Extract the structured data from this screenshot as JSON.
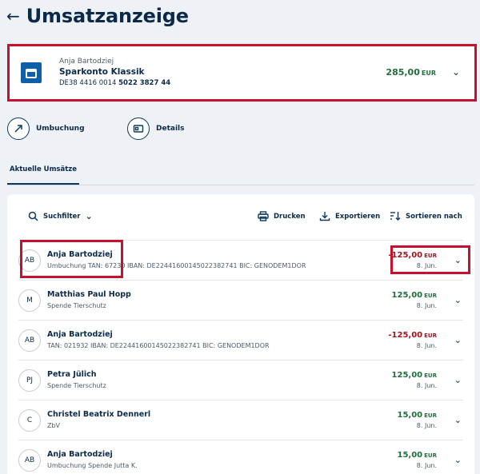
{
  "header": {
    "back_icon": "arrow-left-icon",
    "title": "Umsatzanzeige"
  },
  "account": {
    "owner": "Anja Bartodziej",
    "name": "Sparkonto Klassik",
    "iban_prefix": "DE38 4416 0014",
    "iban_suffix": "5022 3827 44",
    "amount": "285,00",
    "currency": "EUR"
  },
  "actions": {
    "transfer_label": "Umbuchung",
    "details_label": "Details"
  },
  "tabs": {
    "current_label": "Aktuelle Umsätze"
  },
  "toolbar": {
    "filter_label": "Suchfilter",
    "print_label": "Drucken",
    "export_label": "Exportieren",
    "sort_label": "Sortieren nach"
  },
  "transactions": [
    {
      "initials": "AB",
      "name": "Anja Bartodziej",
      "description": "Umbuchung TAN: 67230 IBAN: DE22441600145022382741 BIC: GENODEM1DOR",
      "amount": "-125,00",
      "currency": "EUR",
      "date": "8. Jun.",
      "negative": true
    },
    {
      "initials": "M",
      "name": "Matthias Paul Hopp",
      "description": "Spende Tierschutz",
      "amount": "125,00",
      "currency": "EUR",
      "date": "8. Jun.",
      "negative": false
    },
    {
      "initials": "AB",
      "name": "Anja Bartodziej",
      "description": "TAN: 021932 IBAN: DE22441600145022382741 BIC: GENODEM1DOR",
      "amount": "-125,00",
      "currency": "EUR",
      "date": "8. Jun.",
      "negative": true
    },
    {
      "initials": "PJ",
      "name": "Petra Jülich",
      "description": "Spende Tierschutz",
      "amount": "125,00",
      "currency": "EUR",
      "date": "8. Jun.",
      "negative": false
    },
    {
      "initials": "C",
      "name": "Christel Beatrix Dennerl",
      "description": "ZbV",
      "amount": "15,00",
      "currency": "EUR",
      "date": "8. Jun.",
      "negative": false
    },
    {
      "initials": "AB",
      "name": "Anja Bartodziej",
      "description": "Umbuchung Spende Jutta K.",
      "amount": "15,00",
      "currency": "EUR",
      "date": "8. Jun.",
      "negative": false
    }
  ],
  "colors": {
    "accent": "#0b2a4a",
    "positive": "#1f6e3d",
    "negative": "#a0141f",
    "highlight": "#c8102e"
  }
}
